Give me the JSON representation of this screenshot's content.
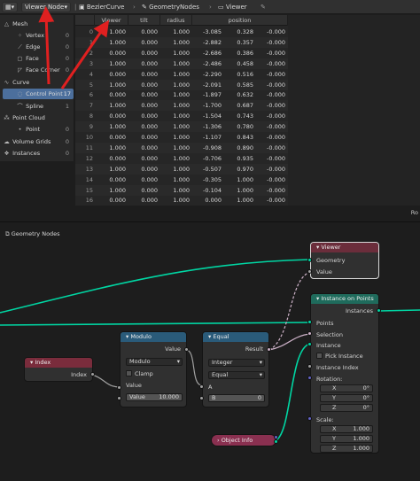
{
  "header": {
    "editor_type_icon": "spreadsheet-editor-icon",
    "viewer_dropdown": "Viewer Node",
    "breadcrumbs": [
      "BezierCurve",
      "GeometryNodes",
      "Viewer"
    ],
    "pin_icon": "pin-icon"
  },
  "outliner": {
    "items": [
      {
        "label": "Mesh",
        "count": "",
        "icon": "mesh-icon"
      },
      {
        "label": "Vertex",
        "count": "0",
        "icon": "vertex-icon"
      },
      {
        "label": "Edge",
        "count": "0",
        "icon": "edge-icon"
      },
      {
        "label": "Face",
        "count": "0",
        "icon": "face-icon"
      },
      {
        "label": "Face Corner",
        "count": "0",
        "icon": "face-corner-icon"
      },
      {
        "label": "Curve",
        "count": "",
        "icon": "curve-icon"
      },
      {
        "label": "Control Point",
        "count": "17",
        "icon": "control-point-icon"
      },
      {
        "label": "Spline",
        "count": "1",
        "icon": "spline-icon"
      },
      {
        "label": "Point Cloud",
        "count": "",
        "icon": "point-cloud-icon"
      },
      {
        "label": "Point",
        "count": "0",
        "icon": "point-icon"
      },
      {
        "label": "Volume Grids",
        "count": "0",
        "icon": "volume-icon"
      },
      {
        "label": "Instances",
        "count": "0",
        "icon": "instances-icon"
      }
    ]
  },
  "spreadsheet": {
    "columns": [
      "Viewer",
      "tilt",
      "radius",
      "position"
    ],
    "rows": [
      [
        "0",
        "1.000",
        "0.000",
        "1.000",
        "-3.085",
        "0.328",
        "-0.000"
      ],
      [
        "1",
        "1.000",
        "0.000",
        "1.000",
        "-2.882",
        "0.357",
        "-0.000"
      ],
      [
        "2",
        "0.000",
        "0.000",
        "1.000",
        "-2.686",
        "0.386",
        "-0.000"
      ],
      [
        "3",
        "1.000",
        "0.000",
        "1.000",
        "-2.486",
        "0.458",
        "-0.000"
      ],
      [
        "4",
        "0.000",
        "0.000",
        "1.000",
        "-2.290",
        "0.516",
        "-0.000"
      ],
      [
        "5",
        "1.000",
        "0.000",
        "1.000",
        "-2.091",
        "0.585",
        "-0.000"
      ],
      [
        "6",
        "0.000",
        "0.000",
        "1.000",
        "-1.897",
        "0.632",
        "-0.000"
      ],
      [
        "7",
        "1.000",
        "0.000",
        "1.000",
        "-1.700",
        "0.687",
        "-0.000"
      ],
      [
        "8",
        "0.000",
        "0.000",
        "1.000",
        "-1.504",
        "0.743",
        "-0.000"
      ],
      [
        "9",
        "1.000",
        "0.000",
        "1.000",
        "-1.306",
        "0.780",
        "-0.000"
      ],
      [
        "10",
        "0.000",
        "0.000",
        "1.000",
        "-1.107",
        "0.843",
        "-0.000"
      ],
      [
        "11",
        "1.000",
        "0.000",
        "1.000",
        "-0.908",
        "0.890",
        "-0.000"
      ],
      [
        "12",
        "0.000",
        "0.000",
        "1.000",
        "-0.706",
        "0.935",
        "-0.000"
      ],
      [
        "13",
        "1.000",
        "0.000",
        "1.000",
        "-0.507",
        "0.970",
        "-0.000"
      ],
      [
        "14",
        "0.000",
        "0.000",
        "1.000",
        "-0.305",
        "1.000",
        "-0.000"
      ],
      [
        "15",
        "1.000",
        "0.000",
        "1.000",
        "-0.104",
        "1.000",
        "-0.000"
      ],
      [
        "16",
        "0.000",
        "0.000",
        "1.000",
        "0.000",
        "1.000",
        "-0.000"
      ]
    ],
    "rows_label": "Ro"
  },
  "node_editor": {
    "title": "Geometry Nodes",
    "nodes": {
      "index": {
        "title": "Index",
        "output": "Index",
        "color": "#7a2c3c"
      },
      "modulo": {
        "title": "Modulo",
        "output": "Value",
        "operation": "Modulo",
        "clamp": "Clamp",
        "input": "Value",
        "value_label": "Value",
        "value": "10.000",
        "color": "#2a5b7a"
      },
      "equal": {
        "title": "Equal",
        "output": "Result",
        "type": "Integer",
        "mode": "Equal",
        "a": "A",
        "b_label": "B",
        "b_value": "0",
        "color": "#2a5b7a"
      },
      "viewer": {
        "title": "Viewer",
        "geometry": "Geometry",
        "value": "Value",
        "color": "#6b2d3b"
      },
      "instance_on_points": {
        "title": "Instance on Points",
        "output": "Instances",
        "points": "Points",
        "selection": "Selection",
        "instance": "Instance",
        "pick_instance": "Pick Instance",
        "instance_index": "Instance Index",
        "rotation": "Rotation:",
        "rot": [
          {
            "axis": "X",
            "value": "0°"
          },
          {
            "axis": "Y",
            "value": "0°"
          },
          {
            "axis": "Z",
            "value": "0°"
          }
        ],
        "scale": "Scale:",
        "sc": [
          {
            "axis": "X",
            "value": "1.000"
          },
          {
            "axis": "Y",
            "value": "1.000"
          },
          {
            "axis": "Z",
            "value": "1.000"
          }
        ],
        "color": "#1f6b5c"
      },
      "object_info": {
        "title": "Object Info",
        "color": "#8a3050"
      }
    }
  },
  "colors": {
    "accent_arrow": "#e02020",
    "geometry_socket": "#00d6a3",
    "float_socket": "#a1a1a1",
    "bool_socket": "#ccb1c7",
    "vector_socket": "#6363c7"
  }
}
